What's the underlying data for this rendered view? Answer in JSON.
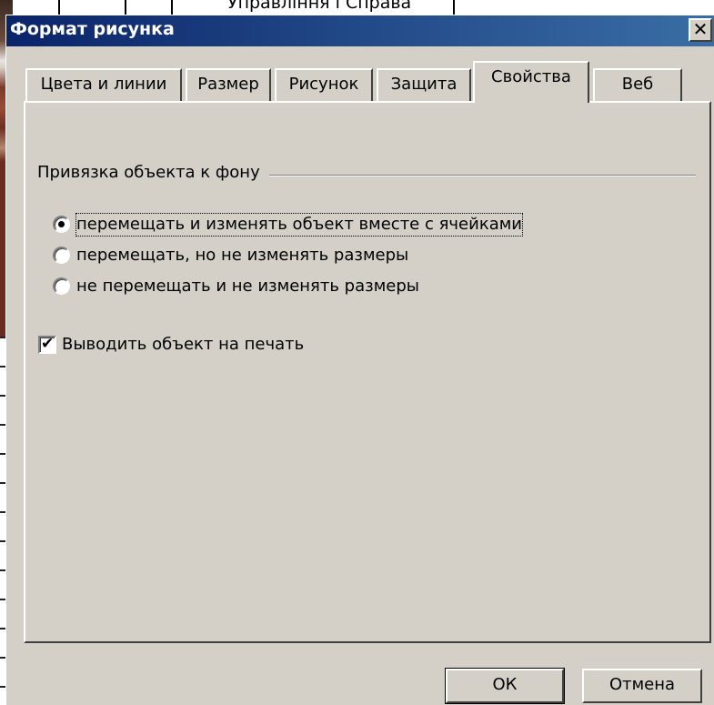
{
  "background": {
    "cell_text": "Управління і Справа"
  },
  "dialog": {
    "title": "Формат рисунка",
    "close_glyph": "✕",
    "tabs": [
      {
        "label": "Цвета и линии",
        "active": false
      },
      {
        "label": "Размер",
        "active": false
      },
      {
        "label": "Рисунок",
        "active": false
      },
      {
        "label": "Защита",
        "active": false
      },
      {
        "label": "Свойства",
        "active": true
      },
      {
        "label": "Веб",
        "active": false
      }
    ],
    "group_label": "Привязка объекта к фону",
    "options": [
      {
        "label": "перемещать и изменять объект вместе с ячейками",
        "checked": true
      },
      {
        "label": "перемещать, но не изменять размеры",
        "checked": false
      },
      {
        "label": "не перемещать и не изменять размеры",
        "checked": false
      }
    ],
    "print_checkbox": {
      "label": "Выводить объект на печать",
      "checked": true
    },
    "ok_label": "ОК",
    "cancel_label": "Отмена"
  }
}
